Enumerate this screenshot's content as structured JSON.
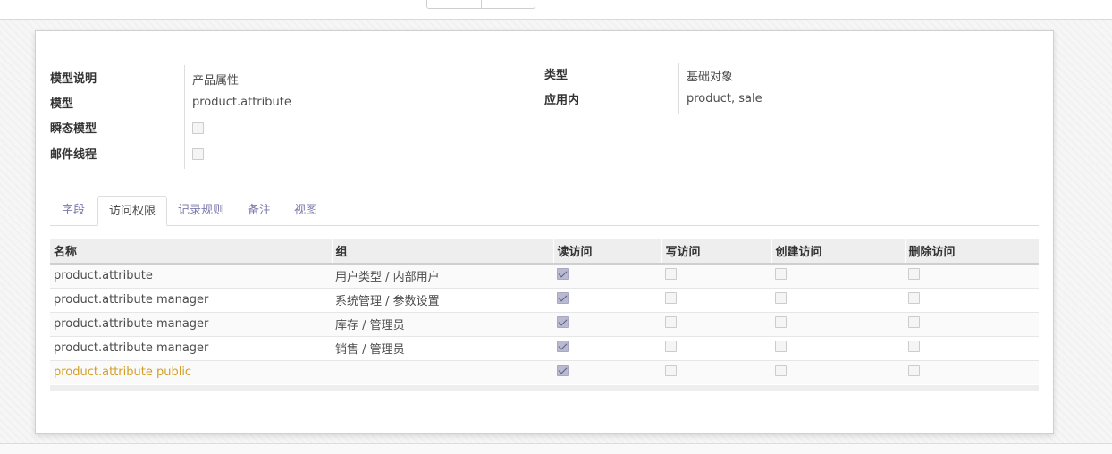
{
  "form": {
    "left_fields": [
      {
        "label": "模型说明",
        "value": "产品属性"
      },
      {
        "label": "模型",
        "value": "product.attribute"
      },
      {
        "label": "瞬态模型",
        "checked": false
      },
      {
        "label": "邮件线程",
        "checked": false
      }
    ],
    "right_fields": [
      {
        "label": "类型",
        "value": "基础对象"
      },
      {
        "label": "应用内",
        "value": "product, sale"
      }
    ]
  },
  "tabs": [
    {
      "label": "字段",
      "active": false
    },
    {
      "label": "访问权限",
      "active": true
    },
    {
      "label": "记录规则",
      "active": false
    },
    {
      "label": "备注",
      "active": false
    },
    {
      "label": "视图",
      "active": false
    }
  ],
  "access_table": {
    "columns": [
      "名称",
      "组",
      "读访问",
      "写访问",
      "创建访问",
      "删除访问"
    ],
    "rows": [
      {
        "name": "product.attribute",
        "group": "用户类型 / 内部用户",
        "read": true,
        "write": false,
        "create": false,
        "unlink": false
      },
      {
        "name": "product.attribute manager",
        "group": "系统管理 / 参数设置",
        "read": true,
        "write": false,
        "create": false,
        "unlink": false
      },
      {
        "name": "product.attribute manager",
        "group": "库存 / 管理员",
        "read": true,
        "write": false,
        "create": false,
        "unlink": false
      },
      {
        "name": "product.attribute manager",
        "group": "销售 / 管理员",
        "read": true,
        "write": false,
        "create": false,
        "unlink": false
      },
      {
        "name": "product.attribute public",
        "group": "",
        "read": true,
        "write": false,
        "create": false,
        "unlink": false
      }
    ]
  },
  "colors": {
    "link": "#7c7bad",
    "highlight_row": "#d39e24"
  }
}
